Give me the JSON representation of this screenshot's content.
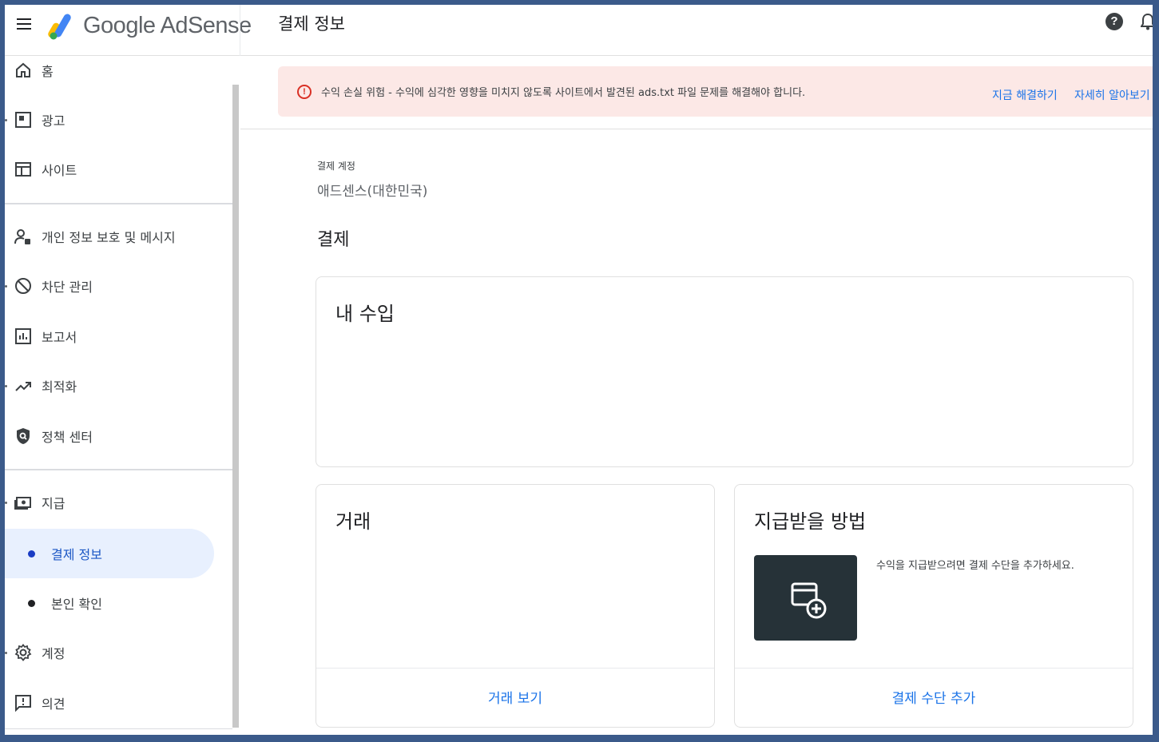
{
  "header": {
    "logo_text": "Google AdSense",
    "page_title": "결제 정보"
  },
  "sidebar": {
    "items": [
      {
        "label": "홈"
      },
      {
        "label": "광고"
      },
      {
        "label": "사이트"
      },
      {
        "label": "개인 정보 보호 및 메시지"
      },
      {
        "label": "차단 관리"
      },
      {
        "label": "보고서"
      },
      {
        "label": "최적화"
      },
      {
        "label": "정책 센터"
      },
      {
        "label": "지급"
      },
      {
        "label": "계정"
      },
      {
        "label": "의견"
      }
    ],
    "sub_items": [
      {
        "label": "결제 정보",
        "active": true
      },
      {
        "label": "본인 확인",
        "active": false
      }
    ]
  },
  "banner": {
    "icon": "!",
    "text": "수익 손실 위험 - 수익에 심각한 영향을 미치지 않도록 사이트에서 발견된 ads.txt 파일 문제를 해결해야 합니다.",
    "fix_link": "지금 해결하기",
    "learn_link": "자세히 알아보기"
  },
  "account": {
    "label": "결제 계정",
    "value": "애드센스(대한민국)"
  },
  "section_title": "결제",
  "cards": {
    "earnings": {
      "title": "내 수입"
    },
    "transactions": {
      "title": "거래",
      "link": "거래 보기"
    },
    "payment_method": {
      "title": "지급받을 방법",
      "description": "수익을 지급받으려면 결제 수단을 추가하세요.",
      "link": "결제 수단 추가"
    }
  },
  "colors": {
    "accent": "#1a73e8",
    "banner_bg": "#fce8e6",
    "error": "#d93025",
    "active_nav_bg": "#e8f0fe"
  }
}
